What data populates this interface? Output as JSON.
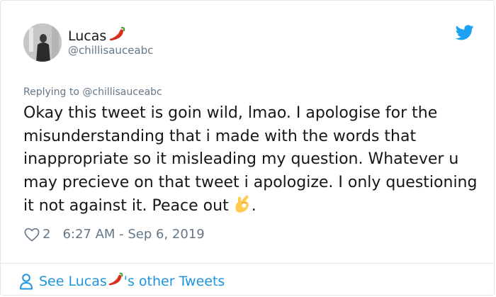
{
  "author": {
    "name": "Lucas",
    "name_emoji": "chili-pepper-icon",
    "handle": "@chillisauceabc",
    "avatar": "avatar-photo"
  },
  "header": {
    "brand_icon": "twitter-bird-icon",
    "brand_color": "#1da1f2"
  },
  "tweet": {
    "replying_to": "Replying to @chillisauceabc",
    "text": "Okay this tweet is goin wild, lmao. I apologise for the misunderstanding that i made with the words that inappropriate so it misleading my question. Whatever u may precieve on that tweet i apologize. I only questioning it not against it. Peace out",
    "text_emoji": "ok-hand-icon",
    "text_end": ".",
    "like_count": "2",
    "timestamp": "6:27 AM - Sep 6, 2019"
  },
  "footer": {
    "see_more_prefix": "See Lucas",
    "see_more_suffix": "'s other Tweets",
    "link_color": "#1b95e0"
  }
}
